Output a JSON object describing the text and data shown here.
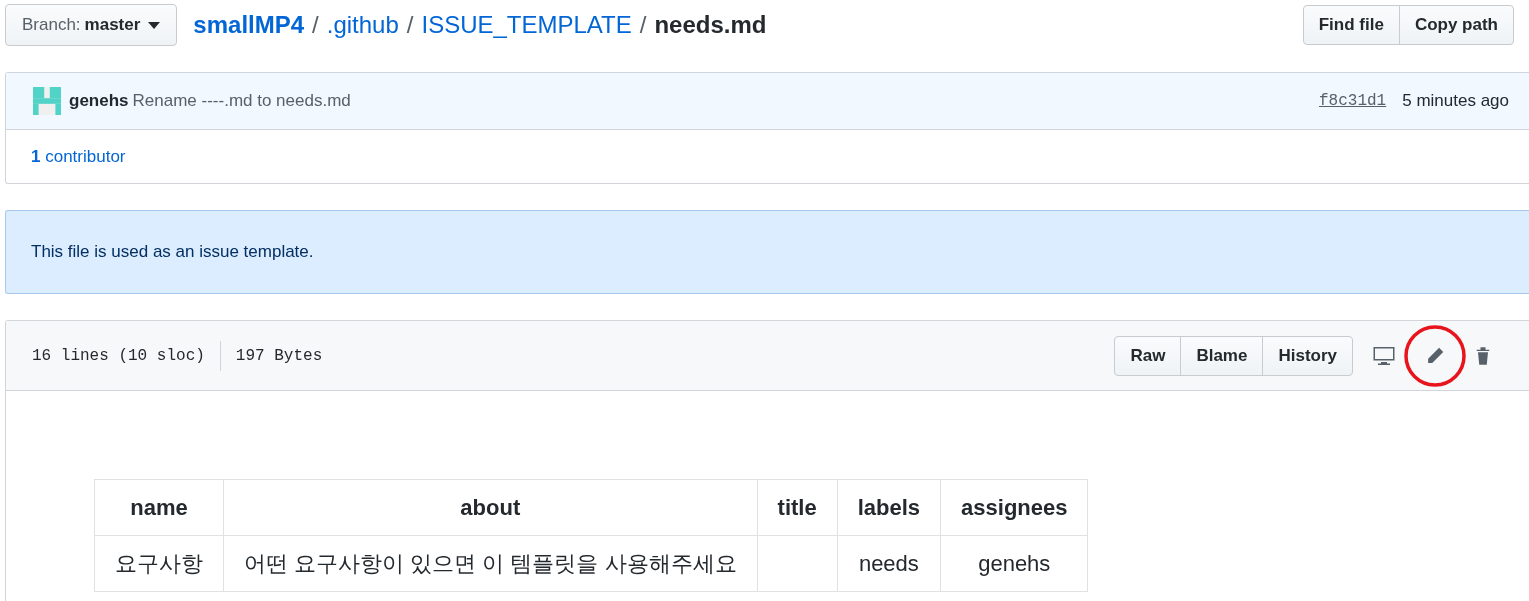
{
  "branch": {
    "label": "Branch:",
    "value": "master"
  },
  "breadcrumb_separator": "/",
  "breadcrumb": [
    {
      "text": "smallMP4",
      "kind": "repo"
    },
    {
      "text": ".github",
      "kind": "link"
    },
    {
      "text": "ISSUE_TEMPLATE",
      "kind": "link"
    },
    {
      "text": "needs.md",
      "kind": "current"
    }
  ],
  "file_actions": [
    "Find file",
    "Copy path"
  ],
  "commit": {
    "author": "genehs",
    "message": "Rename ----.md to needs.md",
    "sha": "f8c31d1",
    "time": "5 minutes ago"
  },
  "contributors": {
    "count": "1",
    "label": "contributor"
  },
  "flash": "This file is used as an issue template.",
  "file_info": {
    "lines": "16 lines (10 sloc)",
    "size": "197 Bytes"
  },
  "file_buttons": [
    "Raw",
    "Blame",
    "History"
  ],
  "table": {
    "columns": [
      "name",
      "about",
      "title",
      "labels",
      "assignees"
    ],
    "rows": [
      [
        "요구사항",
        "어떤 요구사항이 있으면 이 템플릿을 사용해주세요",
        "",
        "needs",
        "genehs"
      ]
    ]
  }
}
